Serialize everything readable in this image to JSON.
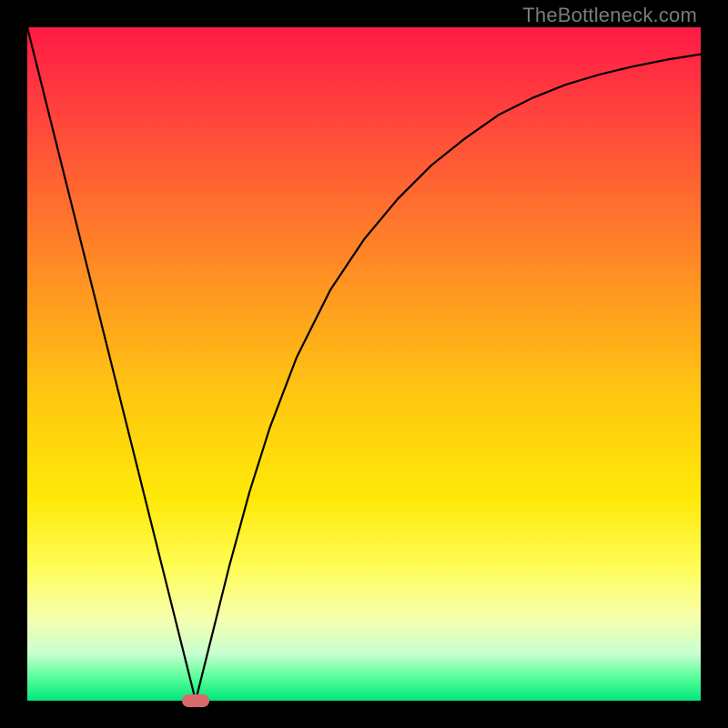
{
  "watermark": "TheBottleneck.com",
  "chart_data": {
    "type": "line",
    "title": "",
    "xlabel": "",
    "ylabel": "",
    "xlim": [
      0,
      1
    ],
    "ylim": [
      0,
      1
    ],
    "background_gradient": {
      "stops": [
        {
          "offset": 0.0,
          "color": "#ff1a45"
        },
        {
          "offset": 0.1,
          "color": "#ff3a3f"
        },
        {
          "offset": 0.25,
          "color": "#ff6a30"
        },
        {
          "offset": 0.4,
          "color": "#ff9a20"
        },
        {
          "offset": 0.55,
          "color": "#ffc810"
        },
        {
          "offset": 0.7,
          "color": "#ffe908"
        },
        {
          "offset": 0.8,
          "color": "#fffd55"
        },
        {
          "offset": 0.88,
          "color": "#f6ffb0"
        },
        {
          "offset": 0.93,
          "color": "#c7ffcf"
        },
        {
          "offset": 0.965,
          "color": "#5bff9c"
        },
        {
          "offset": 1.0,
          "color": "#00e67a"
        }
      ]
    },
    "series": [
      {
        "name": "bottleneck-curve",
        "stroke": "#000000",
        "stroke_width": 2.2,
        "x": [
          0.0,
          0.03,
          0.06,
          0.09,
          0.12,
          0.15,
          0.18,
          0.21,
          0.225,
          0.24,
          0.25,
          0.26,
          0.275,
          0.3,
          0.33,
          0.36,
          0.4,
          0.45,
          0.5,
          0.55,
          0.6,
          0.65,
          0.7,
          0.75,
          0.8,
          0.85,
          0.9,
          0.95,
          1.0
        ],
        "y": [
          1.0,
          0.88,
          0.76,
          0.64,
          0.52,
          0.4,
          0.28,
          0.16,
          0.1,
          0.04,
          0.0,
          0.04,
          0.1,
          0.2,
          0.31,
          0.405,
          0.51,
          0.61,
          0.685,
          0.745,
          0.795,
          0.835,
          0.87,
          0.895,
          0.915,
          0.93,
          0.942,
          0.952,
          0.96
        ]
      }
    ],
    "marker": {
      "x": 0.25,
      "y": 0.0,
      "color": "#d86a6e",
      "shape": "rounded-rect",
      "width_frac": 0.041,
      "height_frac": 0.019
    },
    "green_band": {
      "y0": 0.0,
      "y1": 0.05
    }
  }
}
